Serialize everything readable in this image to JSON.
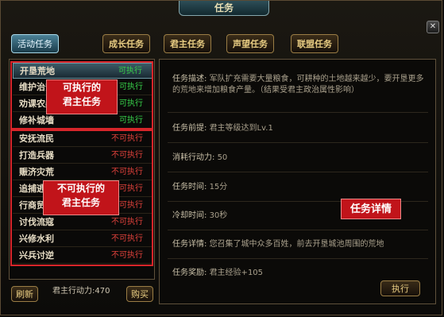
{
  "window": {
    "title": "任务",
    "close_icon": "close-icon"
  },
  "tabs": [
    {
      "label": "活动任务",
      "active": true
    },
    {
      "label": "成长任务",
      "active": false
    },
    {
      "label": "君主任务",
      "active": false
    },
    {
      "label": "声望任务",
      "active": false
    },
    {
      "label": "联盟任务",
      "active": false
    }
  ],
  "quests": [
    {
      "name": "开垦荒地",
      "status": "可执行",
      "executable": true,
      "selected": true
    },
    {
      "name": "维护治安",
      "status": "可执行",
      "executable": true
    },
    {
      "name": "劝课农桑",
      "status": "可执行",
      "executable": true
    },
    {
      "name": "修补城墙",
      "status": "可执行",
      "executable": true
    },
    {
      "name": "安抚流民",
      "status": "不可执行",
      "executable": false
    },
    {
      "name": "打造兵器",
      "status": "不可执行",
      "executable": false
    },
    {
      "name": "赈济灾荒",
      "status": "不可执行",
      "executable": false
    },
    {
      "name": "追捕逃犯",
      "status": "不可执行",
      "executable": false
    },
    {
      "name": "行商贸易",
      "status": "不可执行",
      "executable": false
    },
    {
      "name": "讨伐流寇",
      "status": "不可执行",
      "executable": false
    },
    {
      "name": "兴修水利",
      "status": "不可执行",
      "executable": false
    },
    {
      "name": "兴兵讨逆",
      "status": "不可执行",
      "executable": false
    }
  ],
  "annotations": {
    "executable": "可执行的\n君主任务",
    "not_executable": "不可执行的\n君主任务",
    "details": "任务详情"
  },
  "bottom": {
    "refresh_label": "刷新",
    "action_points": "君主行动力:470",
    "buy_label": "购买"
  },
  "details": {
    "desc_label": "任务描述:",
    "desc_value": "军队扩充需要大量粮食，可耕种的土地越来越少，要开垦更多的荒地来增加粮食产量。（结果受君主政治属性影响）",
    "prereq_label": "任务前提:",
    "prereq_value": "君主等级达到Lv.1",
    "cost_label": "消耗行动力:",
    "cost_value": "50",
    "time_label": "任务时间:",
    "time_value": "15分",
    "cooldown_label": "冷却时间:",
    "cooldown_value": "30秒",
    "detail_label": "任务详情:",
    "detail_value": "您召集了城中众多百姓，前去开垦城池周围的荒地",
    "reward_label": "任务奖励:",
    "reward_value": "君主经验+105",
    "execute_label": "执行"
  }
}
